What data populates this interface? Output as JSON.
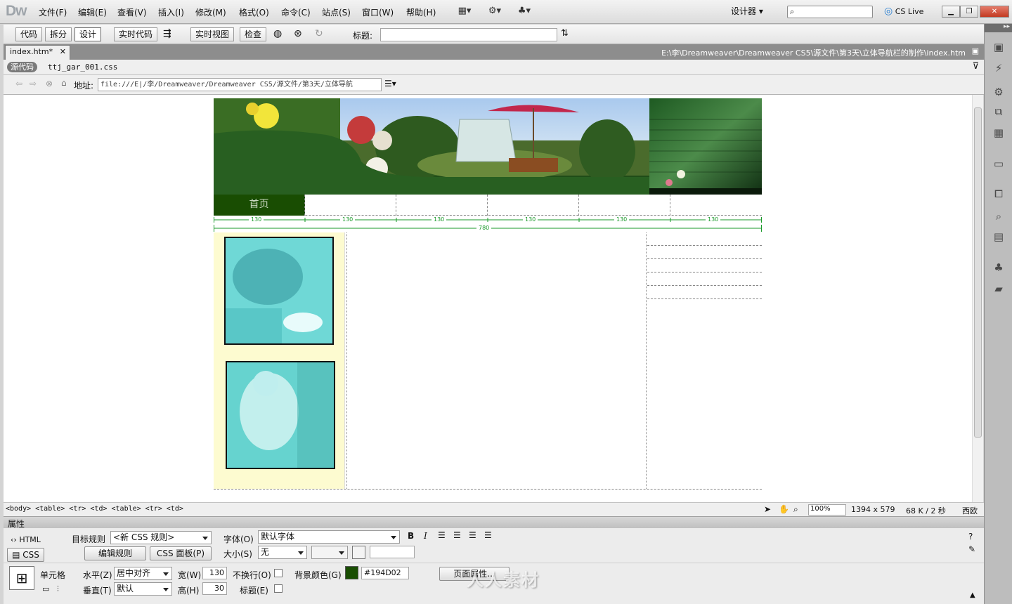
{
  "app": {
    "logo": "Dw"
  },
  "menu": [
    "文件(F)",
    "编辑(E)",
    "查看(V)",
    "插入(I)",
    "修改(M)",
    "格式(O)",
    "命令(C)",
    "站点(S)",
    "窗口(W)",
    "帮助(H)"
  ],
  "toolbar_icons": [
    "layout-icon",
    "gear-icon",
    "site-icon"
  ],
  "workspace": {
    "label": "设计器"
  },
  "cs_live": "CS Live",
  "doc_toolbar": {
    "buttons": [
      "代码",
      "拆分",
      "设计",
      "实时代码",
      "实时视图",
      "检查"
    ],
    "active_view": "设计",
    "title_label": "标题:",
    "title_value": ""
  },
  "tab": {
    "name": "index.htm*",
    "path": "E:\\李\\Dreamweaver\\Dreamweaver CS5\\源文件\\第3天\\立体导航栏的制作\\index.htm"
  },
  "related": {
    "source_label": "源代码",
    "css_file": "ttj_gar_001.css"
  },
  "address": {
    "label": "地址:",
    "value": "file:///E|/李/Dreamweaver/Dreamweaver CS5/源文件/第3天/立体导航"
  },
  "page": {
    "nav": [
      "首页",
      "",
      "",
      "",
      "",
      ""
    ],
    "nav_widths": [
      "130",
      "130",
      "130",
      "130",
      "130",
      "130"
    ],
    "total_width": "780",
    "colors": {
      "nav_bg": "#194D02",
      "left_bg": "#fdfbd0"
    }
  },
  "status": {
    "tag_selector": "<body> <table> <tr> <td> <table> <tr> <td>",
    "zoom": "100%",
    "dimensions": "1394 x 579",
    "size": "68 K / 2 秒",
    "encoding": "西欧"
  },
  "properties": {
    "header": "属性",
    "html_tab": "HTML",
    "css_tab": "CSS",
    "target_rule_label": "目标规则",
    "target_rule_value": "<新 CSS 规则>",
    "edit_rule": "编辑规则",
    "css_panel": "CSS 面板(P)",
    "font_label": "字体(O)",
    "font_value": "默认字体",
    "size_label": "大小(S)",
    "size_value": "无",
    "cell_label": "单元格",
    "horz_label": "水平(Z)",
    "horz_value": "居中对齐",
    "vert_label": "垂直(T)",
    "vert_value": "默认",
    "width_label": "宽(W)",
    "width_value": "130",
    "height_label": "高(H)",
    "height_value": "30",
    "nowrap_label": "不换行(O)",
    "header_label": "标题(E)",
    "bg_label": "背景颜色(G)",
    "bg_value": "#194D02",
    "page_props": "页面属性..."
  },
  "watermark": "人人素材"
}
